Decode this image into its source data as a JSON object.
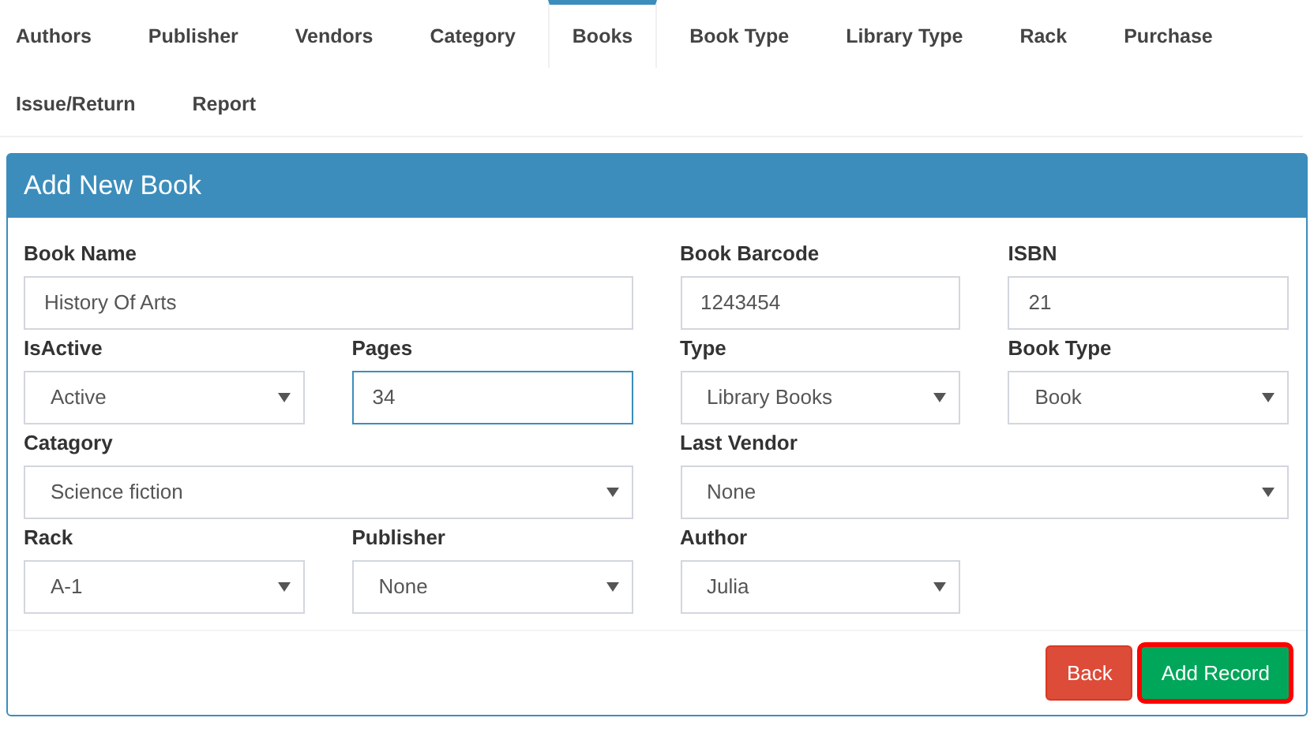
{
  "tabs": [
    {
      "label": "Authors",
      "selected": false
    },
    {
      "label": "Publisher",
      "selected": false
    },
    {
      "label": "Vendors",
      "selected": false
    },
    {
      "label": "Category",
      "selected": false
    },
    {
      "label": "Books",
      "selected": true
    },
    {
      "label": "Book Type",
      "selected": false
    },
    {
      "label": "Library Type",
      "selected": false
    },
    {
      "label": "Rack",
      "selected": false
    },
    {
      "label": "Purchase",
      "selected": false
    },
    {
      "label": "Issue/Return",
      "selected": false
    },
    {
      "label": "Report",
      "selected": false
    }
  ],
  "panel": {
    "title": "Add New Book",
    "fields": [
      {
        "label": "Book Name",
        "kind": "input",
        "value": "History Of Arts",
        "wide": true,
        "focused": false
      },
      {
        "label": "Book Barcode",
        "kind": "input",
        "value": "1243454",
        "wide": false,
        "focused": false
      },
      {
        "label": "ISBN",
        "kind": "input",
        "value": "21",
        "wide": false,
        "focused": false
      },
      {
        "label": "IsActive",
        "kind": "select",
        "value": "Active",
        "wide": false,
        "focused": false
      },
      {
        "label": "Pages",
        "kind": "input",
        "value": "34",
        "wide": false,
        "focused": true
      },
      {
        "label": "Type",
        "kind": "select",
        "value": "Library Books",
        "wide": false,
        "focused": false
      },
      {
        "label": "Book Type",
        "kind": "select",
        "value": "Book",
        "wide": false,
        "focused": false
      },
      {
        "label": "Catagory",
        "kind": "select",
        "value": "Science fiction",
        "wide": true,
        "focused": false
      },
      {
        "label": "Last Vendor",
        "kind": "select",
        "value": "None",
        "wide": true,
        "focused": false
      },
      {
        "label": "Rack",
        "kind": "select",
        "value": "A-1",
        "wide": false,
        "focused": false
      },
      {
        "label": "Publisher",
        "kind": "select",
        "value": "None",
        "wide": false,
        "focused": false
      },
      {
        "label": "Author",
        "kind": "select",
        "value": "Julia",
        "wide": false,
        "focused": false
      }
    ],
    "buttons": [
      {
        "label": "Back",
        "kind": "danger",
        "highlighted": false
      },
      {
        "label": "Add Record",
        "kind": "success",
        "highlighted": true
      }
    ]
  }
}
